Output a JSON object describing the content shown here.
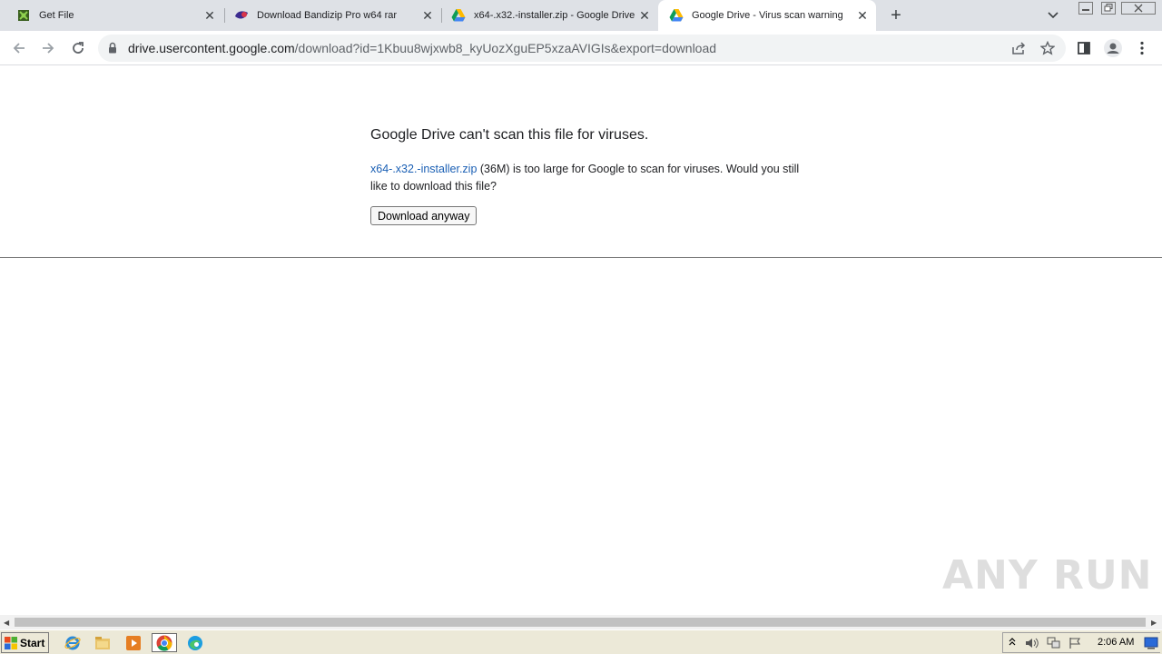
{
  "browser": {
    "tabs": [
      {
        "title": "Get File",
        "favicon": "get-file-icon"
      },
      {
        "title": "Download Bandizip Pro w64 rar",
        "favicon": "bandizip-icon"
      },
      {
        "title": "x64-.x32.-installer.zip - Google Drive",
        "favicon": "google-drive-icon"
      },
      {
        "title": "Google Drive - Virus scan warning",
        "favicon": "google-drive-icon",
        "active": true
      }
    ],
    "url_host": "drive.usercontent.google.com",
    "url_path": "/download?id=1Kbuu8wjxwb8_kyUozXguEP5xzaAVIGIs&export=download"
  },
  "page": {
    "title": "Google Drive can't scan this file for viruses.",
    "file_link": "x64-.x32.-installer.zip",
    "message": " (36M) is too large for Google to scan for viruses. Would you still like to download this file?",
    "button_label": "Download anyway"
  },
  "watermark": "ANY RUN",
  "taskbar": {
    "start_label": "Start",
    "clock": "2:06 AM"
  },
  "colors": {
    "link": "#1a5fb4",
    "tabbar": "#dee1e6",
    "taskbar": "#ece9d8"
  }
}
